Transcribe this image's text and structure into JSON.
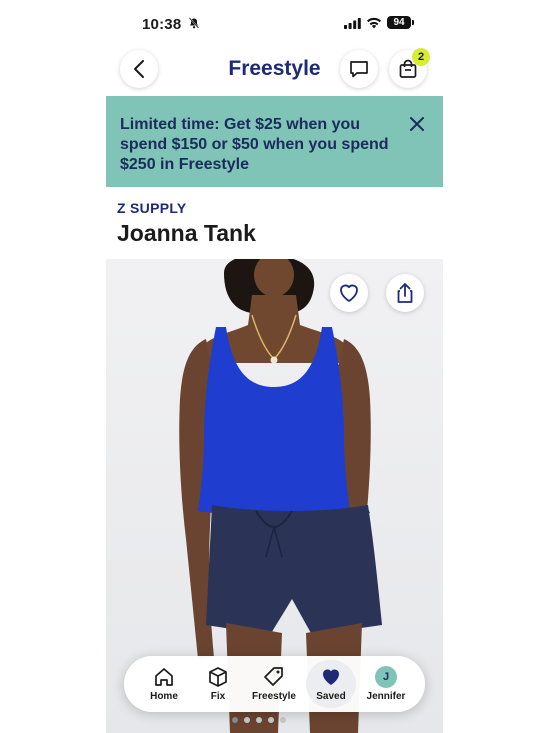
{
  "status_bar": {
    "time": "10:38",
    "battery": "94"
  },
  "header": {
    "title": "Freestyle",
    "cart_count": "2"
  },
  "promo": {
    "text": "Limited time: Get $25 when you spend $150 or $50 when you spend $250 in Freestyle"
  },
  "product": {
    "brand": "Z SUPPLY",
    "name": "Joanna Tank",
    "image_count": 5,
    "active_image": 1
  },
  "bottom_nav": {
    "items": [
      {
        "label": "Home",
        "icon": "home-icon"
      },
      {
        "label": "Fix",
        "icon": "box-icon"
      },
      {
        "label": "Freestyle",
        "icon": "tag-icon"
      },
      {
        "label": "Saved",
        "icon": "heart-icon"
      },
      {
        "label": "Jennifer",
        "icon": "avatar",
        "initial": "J"
      }
    ],
    "active": "Saved"
  },
  "colors": {
    "brand_navy": "#1e2a78",
    "promo_teal": "#7fc4b6",
    "badge_lime": "#d6ec35",
    "tank_blue": "#1f3dcf",
    "shorts_navy": "#2b3457"
  }
}
